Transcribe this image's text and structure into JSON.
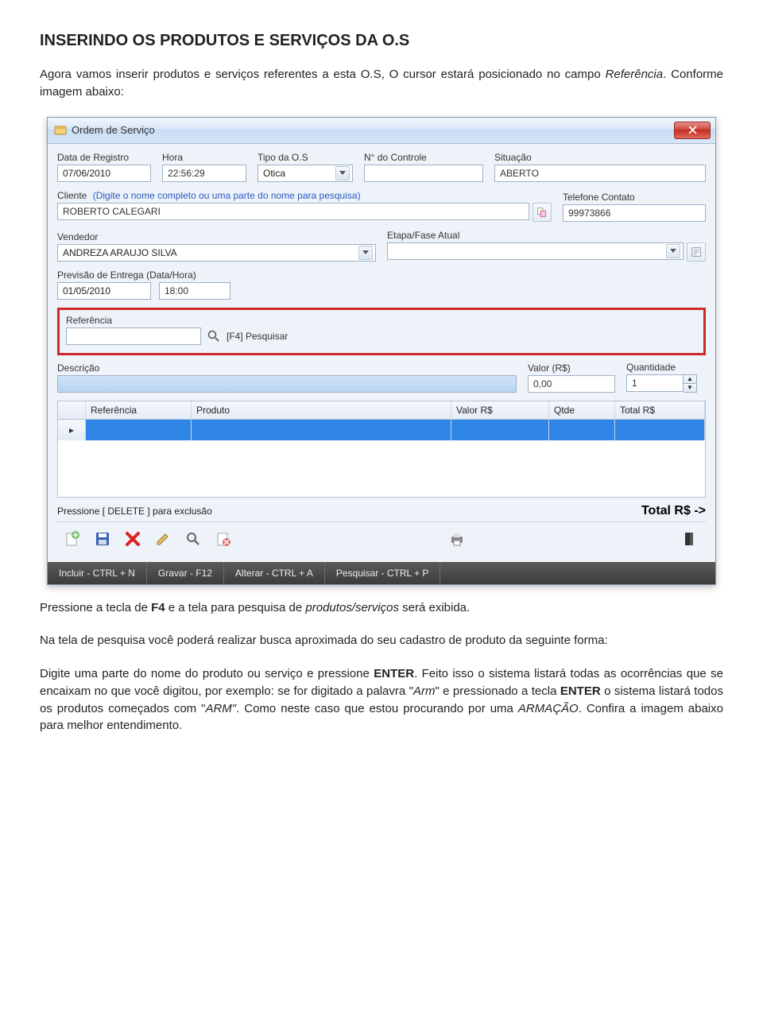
{
  "heading": "INSERINDO OS PRODUTOS E SERVIÇOS DA O.S",
  "intro1a": "Agora vamos inserir produtos e serviços referentes a esta O.S, O cursor estará posicionado no campo ",
  "intro1b": "Referência",
  "intro1c": ". Conforme imagem abaixo:",
  "window": {
    "title": "Ordem de Serviço",
    "labels": {
      "data_reg": "Data de Registro",
      "hora": "Hora",
      "tipo": "Tipo da O.S",
      "ncontrole": "N° do Controle",
      "situacao": "Situação",
      "cliente": "Cliente",
      "cliente_hint": "(Digite o nome completo ou uma parte do nome para pesquisa)",
      "telefone": "Telefone Contato",
      "vendedor": "Vendedor",
      "etapa": "Etapa/Fase Atual",
      "previsao": "Previsão de Entrega (Data/Hora)",
      "referencia": "Referência",
      "pesquisar": "[F4] Pesquisar",
      "descricao": "Descrição",
      "valor": "Valor (R$)",
      "qtd": "Quantidade",
      "grid_ref": "Referência",
      "grid_prod": "Produto",
      "grid_val": "Valor R$",
      "grid_qt": "Qtde",
      "grid_tot": "Total R$",
      "delete_hint": "Pressione [ DELETE ] para exclusão",
      "total": "Total R$ ->"
    },
    "values": {
      "data_reg": "07/06/2010",
      "hora": "22:56:29",
      "tipo": "Otica",
      "ncontrole": "",
      "situacao": "ABERTO",
      "cliente": "ROBERTO CALEGARI",
      "telefone": "99973866",
      "vendedor": "ANDREZA ARAUJO SILVA",
      "etapa": "",
      "prev_data": "01/05/2010",
      "prev_hora": "18:00",
      "referencia": "",
      "descricao": "",
      "valor": "0,00",
      "qtd": "1"
    },
    "shortcuts": {
      "incluir": "Incluir - CTRL + N",
      "gravar": "Gravar - F12",
      "alterar": "Alterar - CTRL + A",
      "pesquisar": "Pesquisar - CTRL + P"
    }
  },
  "after1a": "Pressione a tecla de ",
  "after1b": "F4",
  "after1c": " e a tela para pesquisa de ",
  "after1d": "produtos/serviços",
  "after1e": " será exibida.",
  "after2": "Na tela de pesquisa você poderá realizar busca aproximada do seu cadastro de produto da seguinte forma:",
  "after3a": "Digite uma parte do nome do produto ou serviço e pressione ",
  "after3b": "ENTER",
  "after3c": ". Feito isso o sistema listará todas as ocorrências que se encaixam no que você digitou, por exemplo: se for digitado a palavra \"",
  "after3d": "Arm",
  "after3e": "\" e pressionado a tecla ",
  "after3f": "ENTER",
  "after3g": " o sistema listará todos os produtos começados com \"",
  "after3h": "ARM\"",
  "after3i": ". Como neste caso que estou procurando por uma ",
  "after3j": "ARMAÇÃO",
  "after3k": ". Confira a imagem abaixo para melhor entendimento."
}
